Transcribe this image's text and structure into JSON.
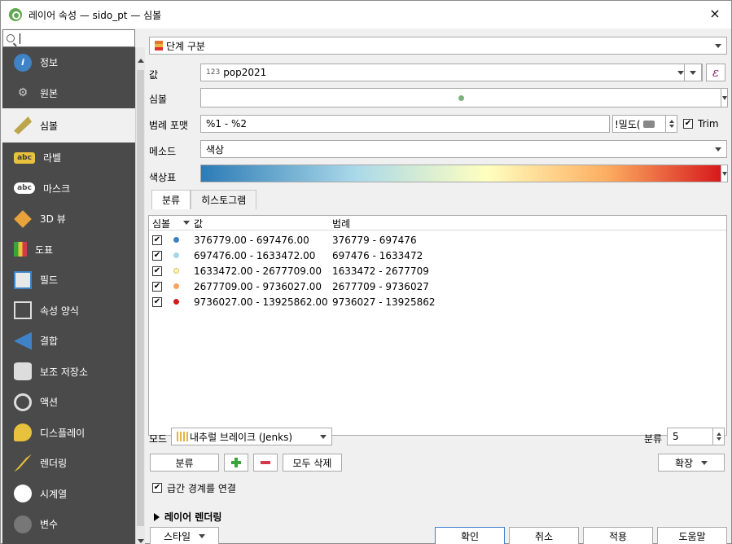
{
  "window": {
    "title": "레이어 속성 — sido_pt — 심볼",
    "close": "×"
  },
  "sidebar": {
    "items": [
      {
        "label": "정보",
        "icon": "info-icon"
      },
      {
        "label": "원본",
        "icon": "source-icon"
      },
      {
        "label": "심볼",
        "icon": "symbology-icon",
        "active": true
      },
      {
        "label": "라벨",
        "icon": "labels-icon"
      },
      {
        "label": "마스크",
        "icon": "masks-icon"
      },
      {
        "label": "3D 뷰",
        "icon": "3d-view-icon"
      },
      {
        "label": "도표",
        "icon": "diagrams-icon"
      },
      {
        "label": "필드",
        "icon": "fields-icon"
      },
      {
        "label": "속성 양식",
        "icon": "attributes-form-icon"
      },
      {
        "label": "결합",
        "icon": "joins-icon"
      },
      {
        "label": "보조 저장소",
        "icon": "auxiliary-storage-icon"
      },
      {
        "label": "액션",
        "icon": "actions-icon"
      },
      {
        "label": "디스플레이",
        "icon": "display-icon"
      },
      {
        "label": "렌더링",
        "icon": "rendering-icon"
      },
      {
        "label": "시계열",
        "icon": "temporal-icon"
      },
      {
        "label": "변수",
        "icon": "variables-icon"
      }
    ]
  },
  "renderer": {
    "type": "단계 구분"
  },
  "value": {
    "label": "값",
    "type_prefix": "123",
    "field": "pop2021"
  },
  "symbol": {
    "label": "심볼"
  },
  "legend_format": {
    "label": "범례 포맷",
    "value": "%1 - %2",
    "precision": "!밀도(",
    "trim_label": "Trim",
    "trim_checked": true
  },
  "method": {
    "label": "메소드",
    "value": "색상"
  },
  "color_ramp": {
    "label": "색상표",
    "colors": [
      "#2c7bb6",
      "#abd9e9",
      "#ffffbf",
      "#fdae61",
      "#d7191c"
    ]
  },
  "tabs": [
    "분류",
    "히스토그램"
  ],
  "table": {
    "headers": {
      "symbol": "심볼",
      "values": "값",
      "legend": "범례"
    },
    "rows": [
      {
        "checked": true,
        "color": "#3f7fc0",
        "values": "376779.00 - 697476.00",
        "legend": "376779 - 697476"
      },
      {
        "checked": true,
        "color": "#a8d4e6",
        "values": "697476.00 - 1633472.00",
        "legend": "697476 - 1633472"
      },
      {
        "checked": true,
        "color": "#fff4b0",
        "values": "1633472.00 - 2677709.00",
        "legend": "1633472 - 2677709"
      },
      {
        "checked": true,
        "color": "#f7a45c",
        "values": "2677709.00 - 9736027.00",
        "legend": "2677709 - 9736027"
      },
      {
        "checked": true,
        "color": "#d7191c",
        "values": "9736027.00 - 13925862.00",
        "legend": "9736027 - 13925862"
      }
    ]
  },
  "mode": {
    "label": "모드",
    "value": "내추럴 브레이크 (Jenks)"
  },
  "classes": {
    "label": "분류",
    "count": "5"
  },
  "buttons": {
    "classify": "분류",
    "delete_all": "모두 삭제",
    "advanced": "확장",
    "link_boundaries": "급간 경계를 연결",
    "layer_rendering": "레이어 렌더링",
    "style": "스타일",
    "ok": "확인",
    "cancel": "취소",
    "apply": "적용",
    "help": "도움말"
  }
}
